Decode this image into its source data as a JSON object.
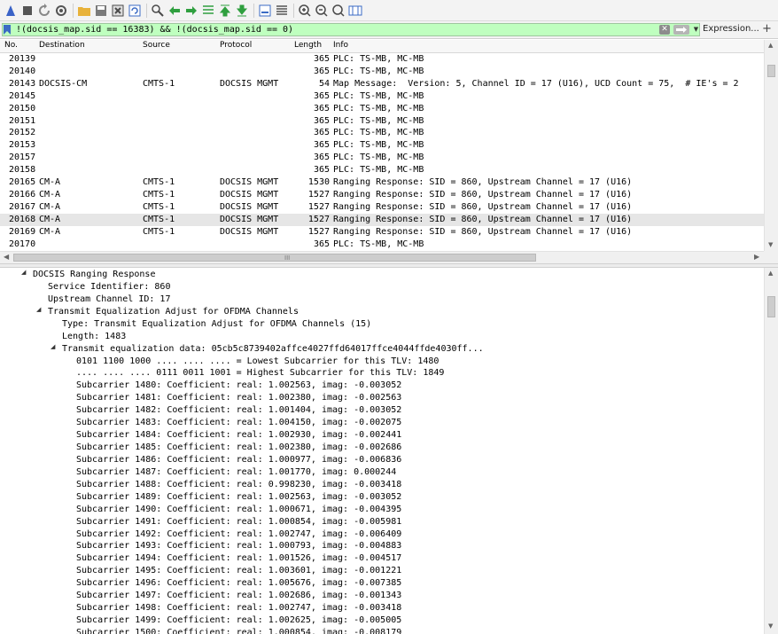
{
  "toolbar": {
    "buttons": [
      {
        "name": "start-capture-icon",
        "color": "#3a63c7"
      },
      {
        "name": "stop-capture-icon",
        "color": "#555555"
      },
      {
        "name": "restart-capture-icon",
        "color": "#888888"
      },
      {
        "name": "capture-options-icon",
        "color": "#555555"
      },
      {
        "name": "open-file-icon",
        "color": "#e8b23a"
      },
      {
        "name": "save-file-icon",
        "color": "#7a7a7a"
      },
      {
        "name": "close-file-icon",
        "color": "#4a4a4a"
      },
      {
        "name": "reload-file-icon",
        "color": "#3b6bc4"
      },
      {
        "name": "find-packet-icon",
        "color": "#4a4a4a"
      },
      {
        "name": "go-back-icon",
        "color": "#2f9f3f"
      },
      {
        "name": "go-forward-icon",
        "color": "#2f9f3f"
      },
      {
        "name": "go-to-packet-icon",
        "color": "#2f9f3f"
      },
      {
        "name": "go-first-packet-icon",
        "color": "#2f9f3f"
      },
      {
        "name": "go-last-packet-icon",
        "color": "#2f9f3f"
      },
      {
        "name": "auto-scroll-icon",
        "color": "#3b6bc4"
      },
      {
        "name": "colorize-icon",
        "color": "#555555"
      },
      {
        "name": "zoom-in-icon",
        "color": "#4a4a4a"
      },
      {
        "name": "zoom-out-icon",
        "color": "#4a4a4a"
      },
      {
        "name": "normal-size-icon",
        "color": "#4a4a4a"
      },
      {
        "name": "resize-columns-icon",
        "color": "#3b6bc4"
      }
    ]
  },
  "filter": {
    "value": "!(docsis_map.sid == 16383) && !(docsis_map.sid == 0)",
    "bg_color": "#bfffbf",
    "clear_icon": "clear-filter-icon",
    "apply_icon": "apply-filter-arrow-icon",
    "expression_label": "Expression...",
    "add_label": "+"
  },
  "packet_list": {
    "columns": [
      "No.",
      "Destination",
      "Source",
      "Protocol",
      "Length",
      "Info"
    ],
    "selected_index": 13,
    "rows": [
      {
        "no": "20139",
        "dst": "",
        "src": "",
        "proto": "",
        "len": "365",
        "info": "PLC: TS-MB, MC-MB"
      },
      {
        "no": "20140",
        "dst": "",
        "src": "",
        "proto": "",
        "len": "365",
        "info": "PLC: TS-MB, MC-MB"
      },
      {
        "no": "20143",
        "dst": "DOCSIS-CM",
        "src": "CMTS-1",
        "proto": "DOCSIS MGMT",
        "len": "54",
        "info": "Map Message:  Version: 5, Channel ID = 17 (U16), UCD Count = 75,  # IE's = 2"
      },
      {
        "no": "20145",
        "dst": "",
        "src": "",
        "proto": "",
        "len": "365",
        "info": "PLC: TS-MB, MC-MB"
      },
      {
        "no": "20150",
        "dst": "",
        "src": "",
        "proto": "",
        "len": "365",
        "info": "PLC: TS-MB, MC-MB"
      },
      {
        "no": "20151",
        "dst": "",
        "src": "",
        "proto": "",
        "len": "365",
        "info": "PLC: TS-MB, MC-MB"
      },
      {
        "no": "20152",
        "dst": "",
        "src": "",
        "proto": "",
        "len": "365",
        "info": "PLC: TS-MB, MC-MB"
      },
      {
        "no": "20153",
        "dst": "",
        "src": "",
        "proto": "",
        "len": "365",
        "info": "PLC: TS-MB, MC-MB"
      },
      {
        "no": "20157",
        "dst": "",
        "src": "",
        "proto": "",
        "len": "365",
        "info": "PLC: TS-MB, MC-MB"
      },
      {
        "no": "20158",
        "dst": "",
        "src": "",
        "proto": "",
        "len": "365",
        "info": "PLC: TS-MB, MC-MB"
      },
      {
        "no": "20165",
        "dst": "CM-A",
        "src": "CMTS-1",
        "proto": "DOCSIS MGMT",
        "len": "1530",
        "info": "Ranging Response: SID = 860, Upstream Channel = 17 (U16)"
      },
      {
        "no": "20166",
        "dst": "CM-A",
        "src": "CMTS-1",
        "proto": "DOCSIS MGMT",
        "len": "1527",
        "info": "Ranging Response: SID = 860, Upstream Channel = 17 (U16)"
      },
      {
        "no": "20167",
        "dst": "CM-A",
        "src": "CMTS-1",
        "proto": "DOCSIS MGMT",
        "len": "1527",
        "info": "Ranging Response: SID = 860, Upstream Channel = 17 (U16)"
      },
      {
        "no": "20168",
        "dst": "CM-A",
        "src": "CMTS-1",
        "proto": "DOCSIS MGMT",
        "len": "1527",
        "info": "Ranging Response: SID = 860, Upstream Channel = 17 (U16)"
      },
      {
        "no": "20169",
        "dst": "CM-A",
        "src": "CMTS-1",
        "proto": "DOCSIS MGMT",
        "len": "1527",
        "info": "Ranging Response: SID = 860, Upstream Channel = 17 (U16)"
      },
      {
        "no": "20170",
        "dst": "",
        "src": "",
        "proto": "",
        "len": "365",
        "info": "PLC: TS-MB, MC-MB"
      }
    ],
    "hscroll_grip": "III"
  },
  "detail_tree": {
    "nodes": [
      {
        "text": "DOCSIS Ranging Response",
        "level": 1,
        "expanded": true
      },
      {
        "text": "Service Identifier: 860",
        "level": 2
      },
      {
        "text": "Upstream Channel ID: 17",
        "level": 2
      },
      {
        "text": "Transmit Equalization Adjust for OFDMA Channels",
        "level": 2,
        "expanded": true
      },
      {
        "text": "Type: Transmit Equalization Adjust for OFDMA Channels (15)",
        "level": 3
      },
      {
        "text": "Length: 1483",
        "level": 3
      },
      {
        "text": "Transmit equalization data: 05cb5c8739402affce4027ffd64017ffce4044ffde4030ff...",
        "level": 3,
        "expanded": true
      },
      {
        "text": "0101 1100 1000 .... .... .... = Lowest Subcarrier for this TLV: 1480",
        "level": 4
      },
      {
        "text": ".... .... .... 0111 0011 1001 = Highest Subcarrier for this TLV: 1849",
        "level": 4
      },
      {
        "text": "Subcarrier 1480: Coefficient: real: 1.002563, imag: -0.003052",
        "level": 4
      },
      {
        "text": "Subcarrier 1481: Coefficient: real: 1.002380, imag: -0.002563",
        "level": 4
      },
      {
        "text": "Subcarrier 1482: Coefficient: real: 1.001404, imag: -0.003052",
        "level": 4
      },
      {
        "text": "Subcarrier 1483: Coefficient: real: 1.004150, imag: -0.002075",
        "level": 4
      },
      {
        "text": "Subcarrier 1484: Coefficient: real: 1.002930, imag: -0.002441",
        "level": 4
      },
      {
        "text": "Subcarrier 1485: Coefficient: real: 1.002380, imag: -0.002686",
        "level": 4
      },
      {
        "text": "Subcarrier 1486: Coefficient: real: 1.000977, imag: -0.006836",
        "level": 4
      },
      {
        "text": "Subcarrier 1487: Coefficient: real: 1.001770, imag: 0.000244",
        "level": 4
      },
      {
        "text": "Subcarrier 1488: Coefficient: real: 0.998230, imag: -0.003418",
        "level": 4
      },
      {
        "text": "Subcarrier 1489: Coefficient: real: 1.002563, imag: -0.003052",
        "level": 4
      },
      {
        "text": "Subcarrier 1490: Coefficient: real: 1.000671, imag: -0.004395",
        "level": 4
      },
      {
        "text": "Subcarrier 1491: Coefficient: real: 1.000854, imag: -0.005981",
        "level": 4
      },
      {
        "text": "Subcarrier 1492: Coefficient: real: 1.002747, imag: -0.006409",
        "level": 4
      },
      {
        "text": "Subcarrier 1493: Coefficient: real: 1.000793, imag: -0.004883",
        "level": 4
      },
      {
        "text": "Subcarrier 1494: Coefficient: real: 1.001526, imag: -0.004517",
        "level": 4
      },
      {
        "text": "Subcarrier 1495: Coefficient: real: 1.003601, imag: -0.001221",
        "level": 4
      },
      {
        "text": "Subcarrier 1496: Coefficient: real: 1.005676, imag: -0.007385",
        "level": 4
      },
      {
        "text": "Subcarrier 1497: Coefficient: real: 1.002686, imag: -0.001343",
        "level": 4
      },
      {
        "text": "Subcarrier 1498: Coefficient: real: 1.002747, imag: -0.003418",
        "level": 4
      },
      {
        "text": "Subcarrier 1499: Coefficient: real: 1.002625, imag: -0.005005",
        "level": 4
      },
      {
        "text": "Subcarrier 1500: Coefficient: real: 1.000854, imag: -0.008179",
        "level": 4
      }
    ]
  }
}
